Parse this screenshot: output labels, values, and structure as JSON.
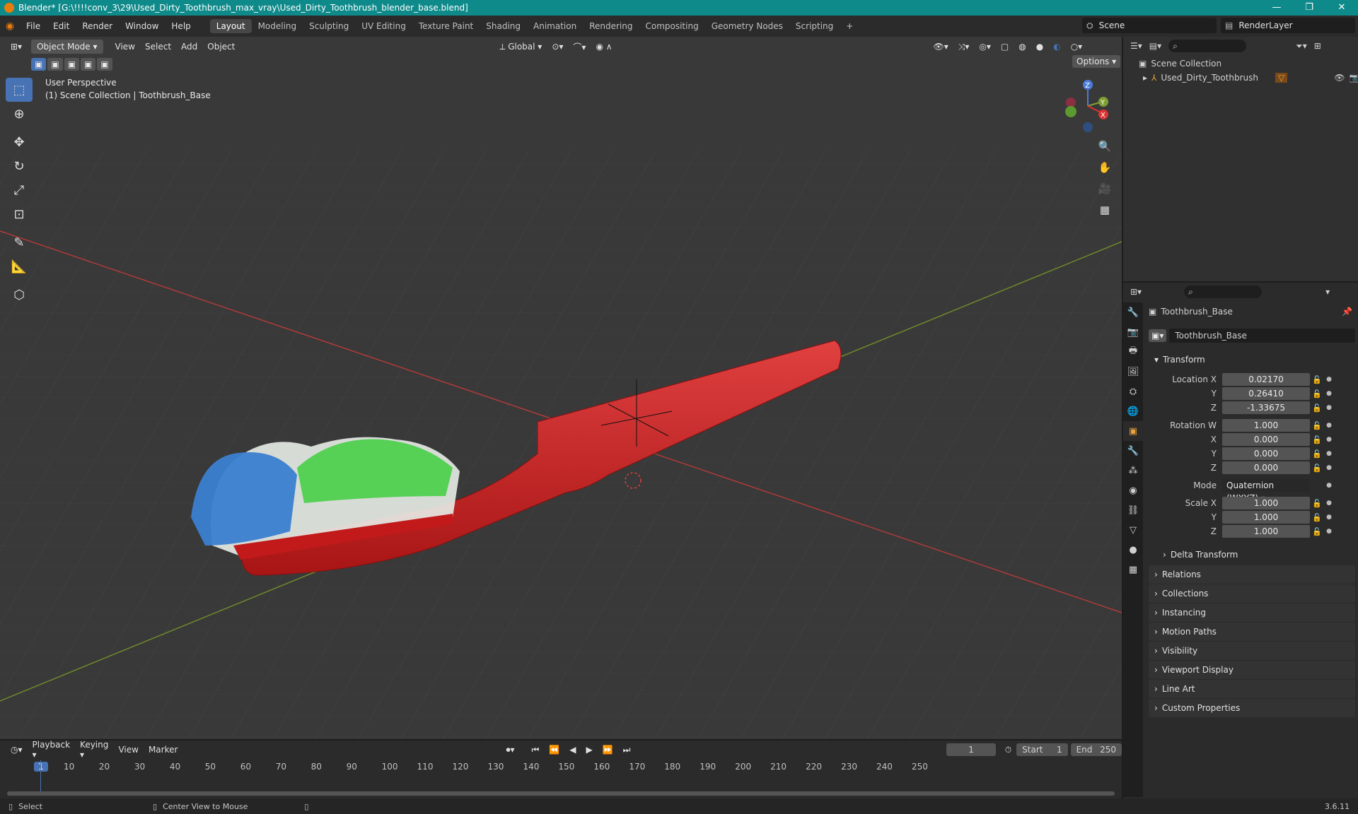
{
  "window": {
    "title": "Blender* [G:\\!!!!conv_3\\29\\Used_Dirty_Toothbrush_max_vray\\Used_Dirty_Toothbrush_blender_base.blend]",
    "minimize": "—",
    "maximize": "❐",
    "close": "✕"
  },
  "menu": [
    "File",
    "Edit",
    "Render",
    "Window",
    "Help"
  ],
  "workspaces": [
    "Layout",
    "Modeling",
    "Sculpting",
    "UV Editing",
    "Texture Paint",
    "Shading",
    "Animation",
    "Rendering",
    "Compositing",
    "Geometry Nodes",
    "Scripting"
  ],
  "workspace_add": "+",
  "scene": "Scene",
  "render_layer": "RenderLayer",
  "viewport": {
    "mode": "Object Mode",
    "menus": [
      "View",
      "Select",
      "Add",
      "Object"
    ],
    "transform_orientation": "Global",
    "options": "Options",
    "perspective": "User Perspective",
    "collection_info": "(1) Scene Collection | Toothbrush_Base",
    "gizmo": {
      "x": "X",
      "y": "Y",
      "z": "Z"
    }
  },
  "outliner": {
    "root": "Scene Collection",
    "items": [
      {
        "label": "Used_Dirty_Toothbrush"
      }
    ]
  },
  "properties": {
    "object_name": "Toothbrush_Base",
    "data_name": "Toothbrush_Base",
    "transform_header": "Transform",
    "location": {
      "label": "Location X",
      "x": "0.02170",
      "y": "0.26410",
      "z": "-1.33675"
    },
    "rotation": {
      "label": "Rotation W",
      "w": "1.000",
      "x": "0.000",
      "y": "0.000",
      "z": "0.000"
    },
    "mode_label": "Mode",
    "mode_value": "Quaternion (WXYZ)",
    "scale": {
      "label": "Scale X",
      "x": "1.000",
      "y": "1.000",
      "z": "1.000"
    },
    "axis_y": "Y",
    "axis_z": "Z",
    "axis_x": "X",
    "delta": "Delta Transform",
    "panels": [
      "Relations",
      "Collections",
      "Instancing",
      "Motion Paths",
      "Visibility",
      "Viewport Display",
      "Line Art",
      "Custom Properties"
    ]
  },
  "timeline": {
    "menus": [
      "Playback",
      "Keying",
      "View",
      "Marker"
    ],
    "current_frame": "1",
    "start_label": "Start",
    "start": "1",
    "end_label": "End",
    "end": "250",
    "ticks": [
      "1",
      "10",
      "20",
      "30",
      "40",
      "50",
      "60",
      "70",
      "80",
      "90",
      "100",
      "110",
      "120",
      "130",
      "140",
      "150",
      "160",
      "170",
      "180",
      "190",
      "200",
      "210",
      "220",
      "230",
      "240",
      "250"
    ]
  },
  "status": {
    "select": "Select",
    "center": "Center View to Mouse",
    "version": "3.6.11"
  },
  "colors": {
    "accent": "#4772b3",
    "titlebar": "#0f8a8a",
    "grid_x": "#b03a3a",
    "grid_y": "#6e8a2a"
  }
}
